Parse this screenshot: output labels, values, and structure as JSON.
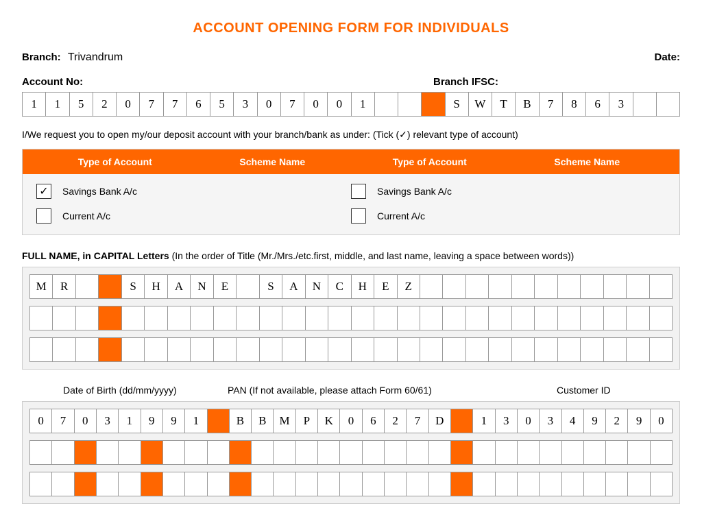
{
  "title": "ACCOUNT OPENING FORM FOR INDIVIDUALS",
  "branch_label": "Branch:",
  "branch_value": "Trivandrum",
  "date_label": "Date:",
  "account_no_label": "Account No:",
  "ifsc_label": "Branch IFSC:",
  "account_no_cells": [
    "1",
    "1",
    "5",
    "2",
    "0",
    "7",
    "7",
    "6",
    "5",
    "3",
    "0",
    "7",
    "0",
    "0",
    "1",
    "",
    "",
    "ORANGE",
    "S",
    "W",
    "T",
    "B",
    "7",
    "8",
    "6",
    "3",
    "",
    ""
  ],
  "request_note": "I/We request you to open my/our deposit account with your branch/bank as under: (Tick (✓) relevant type of account)",
  "acc_head": [
    "Type of Account",
    "Scheme Name",
    "Type of Account",
    "Scheme Name"
  ],
  "acc_left": [
    {
      "label": "Savings Bank A/c",
      "checked": true
    },
    {
      "label": "Current A/c",
      "checked": false
    }
  ],
  "acc_right": [
    {
      "label": "Savings Bank A/c",
      "checked": false
    },
    {
      "label": "Current A/c",
      "checked": false
    }
  ],
  "fullname_label_bold": "FULL NAME, in CAPITAL Letters",
  "fullname_label_rest": " (In the order of Title (Mr./Mrs./etc.first, middle, and last name, leaving a space between words))",
  "name_rows": [
    [
      "M",
      "R",
      "",
      "ORANGE",
      "S",
      "H",
      "A",
      "N",
      "E",
      "",
      "S",
      "A",
      "N",
      "C",
      "H",
      "E",
      "Z",
      "",
      "",
      "",
      "",
      "",
      "",
      "",
      "",
      "",
      "",
      ""
    ],
    [
      "",
      "",
      "",
      "ORANGE",
      "",
      "",
      "",
      "",
      "",
      "",
      "",
      "",
      "",
      "",
      "",
      "",
      "",
      "",
      "",
      "",
      "",
      "",
      "",
      "",
      "",
      "",
      "",
      ""
    ],
    [
      "",
      "",
      "",
      "ORANGE",
      "",
      "",
      "",
      "",
      "",
      "",
      "",
      "",
      "",
      "",
      "",
      "",
      "",
      "",
      "",
      "",
      "",
      "",
      "",
      "",
      "",
      "",
      "",
      ""
    ]
  ],
  "dob_label": "Date of Birth (dd/mm/yyyy)",
  "pan_label": "PAN (If not available, please attach Form 60/61)",
  "cust_label": "Customer ID",
  "bottom_rows": [
    [
      "0",
      "7",
      "0",
      "3",
      "1",
      "9",
      "9",
      "1",
      "ORANGE",
      "B",
      "B",
      "M",
      "P",
      "K",
      "0",
      "6",
      "2",
      "7",
      "D",
      "ORANGE",
      "1",
      "3",
      "0",
      "3",
      "4",
      "9",
      "2",
      "9",
      "0"
    ],
    [
      "",
      "",
      "ORANGE",
      "",
      "",
      "ORANGE",
      "",
      "",
      "",
      "ORANGE",
      "",
      "",
      "",
      "",
      "",
      "",
      "",
      "",
      "",
      "ORANGE",
      "",
      "",
      "",
      "",
      "",
      "",
      "",
      "",
      ""
    ],
    [
      "",
      "",
      "ORANGE",
      "",
      "",
      "ORANGE",
      "",
      "",
      "",
      "ORANGE",
      "",
      "",
      "",
      "",
      "",
      "",
      "",
      "",
      "",
      "ORANGE",
      "",
      "",
      "",
      "",
      "",
      "",
      "",
      "",
      ""
    ]
  ]
}
